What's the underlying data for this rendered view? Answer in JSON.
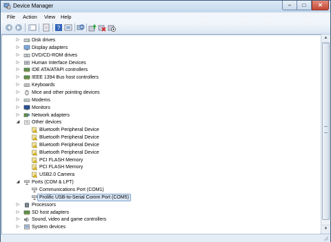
{
  "window": {
    "title": "Device Manager",
    "controls": {
      "minimize": "–",
      "maximize": "□",
      "close": "✕"
    }
  },
  "menu": [
    "File",
    "Action",
    "View",
    "Help"
  ],
  "toolbar_icons": [
    "back-icon",
    "forward-icon",
    "show-hide-tree-icon",
    "properties-icon",
    "help-icon",
    "device-by-type-icon",
    "scan-hardware-icon",
    "update-driver-icon",
    "uninstall-icon",
    "disable-icon"
  ],
  "tree": [
    {
      "label": "Disk drives",
      "level": 1,
      "expander": "closed",
      "icon": "disk-drive-icon"
    },
    {
      "label": "Display adapters",
      "level": 1,
      "expander": "closed",
      "icon": "display-adapter-icon"
    },
    {
      "label": "DVD/CD-ROM drives",
      "level": 1,
      "expander": "closed",
      "icon": "dvd-drive-icon"
    },
    {
      "label": "Human Interface Devices",
      "level": 1,
      "expander": "closed",
      "icon": "hid-icon"
    },
    {
      "label": "IDE ATA/ATAPI controllers",
      "level": 1,
      "expander": "closed",
      "icon": "ide-controller-icon"
    },
    {
      "label": "IEEE 1394 Bus host controllers",
      "level": 1,
      "expander": "closed",
      "icon": "ieee1394-icon"
    },
    {
      "label": "Keyboards",
      "level": 1,
      "expander": "closed",
      "icon": "keyboard-icon"
    },
    {
      "label": "Mice and other pointing devices",
      "level": 1,
      "expander": "closed",
      "icon": "mouse-icon"
    },
    {
      "label": "Modems",
      "level": 1,
      "expander": "closed",
      "icon": "modem-icon"
    },
    {
      "label": "Monitors",
      "level": 1,
      "expander": "closed",
      "icon": "monitor-icon"
    },
    {
      "label": "Network adapters",
      "level": 1,
      "expander": "closed",
      "icon": "network-adapter-icon"
    },
    {
      "label": "Other devices",
      "level": 1,
      "expander": "open",
      "icon": "other-devices-icon"
    },
    {
      "label": "Bluetooth Peripheral Device",
      "level": 2,
      "expander": "none",
      "icon": "unknown-device-warning-icon"
    },
    {
      "label": "Bluetooth Peripheral Device",
      "level": 2,
      "expander": "none",
      "icon": "unknown-device-warning-icon"
    },
    {
      "label": "Bluetooth Peripheral Device",
      "level": 2,
      "expander": "none",
      "icon": "unknown-device-warning-icon"
    },
    {
      "label": "Bluetooth Peripheral Device",
      "level": 2,
      "expander": "none",
      "icon": "unknown-device-warning-icon"
    },
    {
      "label": "PCI FLASH Memory",
      "level": 2,
      "expander": "none",
      "icon": "unknown-device-warning-icon"
    },
    {
      "label": "PCI FLASH Memory",
      "level": 2,
      "expander": "none",
      "icon": "unknown-device-warning-icon"
    },
    {
      "label": "USB2.0 Camera",
      "level": 2,
      "expander": "none",
      "icon": "unknown-device-warning-icon"
    },
    {
      "label": "Ports (COM & LPT)",
      "level": 1,
      "expander": "open",
      "icon": "port-icon"
    },
    {
      "label": "Communications Port (COM1)",
      "level": 2,
      "expander": "none",
      "icon": "port-icon"
    },
    {
      "label": "Prolific USB-to-Serial Comm Port (COM5)",
      "level": 2,
      "expander": "none",
      "icon": "port-icon",
      "selected": true
    },
    {
      "label": "Processors",
      "level": 1,
      "expander": "closed",
      "icon": "processor-icon"
    },
    {
      "label": "SD host adapters",
      "level": 1,
      "expander": "closed",
      "icon": "sd-host-icon"
    },
    {
      "label": "Sound, video and game controllers",
      "level": 1,
      "expander": "closed",
      "icon": "sound-icon"
    },
    {
      "label": "System devices",
      "level": 1,
      "expander": "closed",
      "icon": "system-device-icon"
    }
  ]
}
